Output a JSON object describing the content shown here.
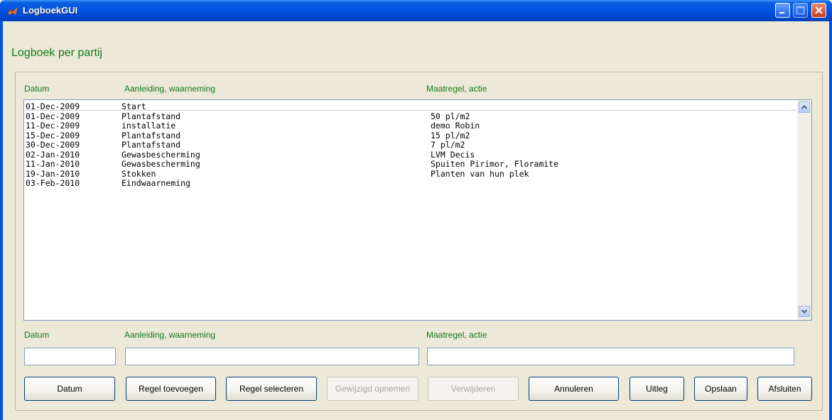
{
  "window": {
    "title": "LogboekGUI"
  },
  "page": {
    "title": "Logboek per partij"
  },
  "list": {
    "headers": {
      "date": "Datum",
      "reason": "Aanleiding, waarneming",
      "action": "Maatregel, actie"
    },
    "rows": [
      {
        "date": "01-Dec-2009",
        "reason": "Start",
        "action": ""
      },
      {
        "date": "01-Dec-2009",
        "reason": "Plantafstand",
        "action": "50 pl/m2"
      },
      {
        "date": "11-Dec-2009",
        "reason": "installatie",
        "action": "demo Robin"
      },
      {
        "date": "15-Dec-2009",
        "reason": "Plantafstand",
        "action": "15 pl/m2"
      },
      {
        "date": "30-Dec-2009",
        "reason": "Plantafstand",
        "action": "7 pl/m2"
      },
      {
        "date": "02-Jan-2010",
        "reason": "Gewasbescherming",
        "action": "LVM Decis"
      },
      {
        "date": "11-Jan-2010",
        "reason": "Gewasbescherming",
        "action": "Spuiten Pirimor, Floramite"
      },
      {
        "date": "19-Jan-2010",
        "reason": "Stokken",
        "action": "Planten van hun plek"
      },
      {
        "date": "03-Feb-2010",
        "reason": "Eindwaarneming",
        "action": ""
      }
    ]
  },
  "form": {
    "labels": {
      "date": "Datum",
      "reason": "Aanleiding, waarneming",
      "action": "Maatregel, actie"
    },
    "values": {
      "date": "",
      "reason": "",
      "action": ""
    }
  },
  "buttons": {
    "datum": "Datum",
    "add_row": "Regel toevoegen",
    "select_row": "Regel selecteren",
    "save_changed": "Gewijzigd opnemen",
    "delete": "Verwijderen",
    "cancel": "Annuleren",
    "explain": "Uitleg",
    "save": "Opslaan",
    "close": "Afsluiten"
  },
  "icons": {
    "app": "matlab-logo-icon",
    "minimize": "minimize-icon",
    "maximize": "maximize-icon",
    "close": "close-icon",
    "scroll_up": "chevron-up-icon",
    "scroll_down": "chevron-down-icon"
  },
  "colors": {
    "label_green": "#157a1a",
    "titlebar_blue": "#0054e3",
    "face": "#ece9d8"
  }
}
